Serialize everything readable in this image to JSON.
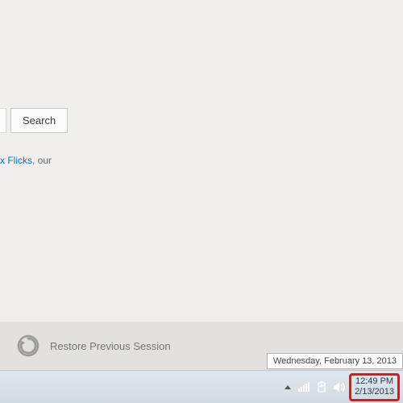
{
  "search": {
    "button_label": "Search"
  },
  "promo": {
    "link_fragment": "x Flicks",
    "trailing_text": ", our"
  },
  "restore": {
    "label": "Restore Previous Session"
  },
  "tooltip": {
    "text": "Wednesday, February 13, 2013"
  },
  "clock": {
    "time": "12:49 PM",
    "date": "2/13/2013"
  }
}
